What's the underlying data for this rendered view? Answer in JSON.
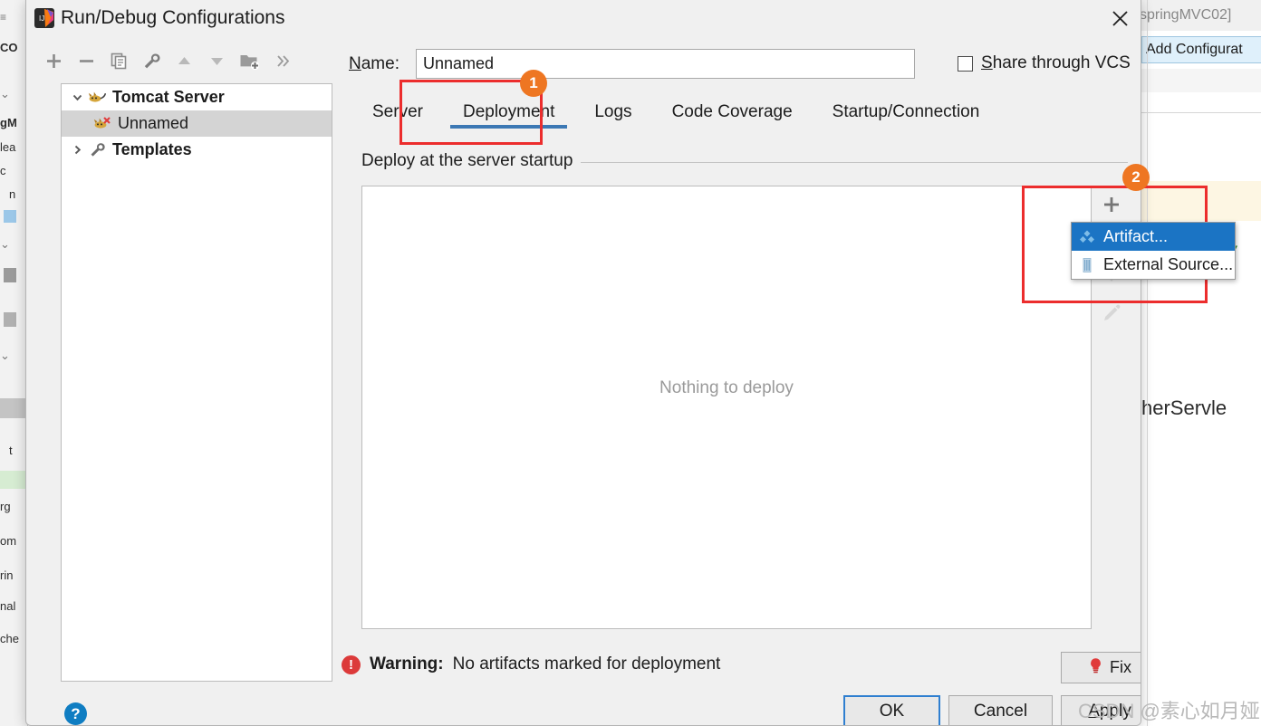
{
  "background": {
    "window_title": "springMVC02]",
    "add_config_button": "Add Configurat",
    "code_comment": "//",
    "code_word": "herServle",
    "left_lines": [
      "CO",
      "gM",
      "lea",
      "c",
      "n",
      "t",
      "rg",
      "om",
      "rin",
      "nal",
      "che"
    ]
  },
  "dialog": {
    "title": "Run/Debug Configurations",
    "title_icon": "intellij-idea-icon",
    "close_icon": "close-icon",
    "toolbar": [
      {
        "name": "add-configuration-button",
        "icon": "plus-icon"
      },
      {
        "name": "remove-configuration-button",
        "icon": "minus-icon"
      },
      {
        "name": "copy-configuration-button",
        "icon": "copy-icon"
      },
      {
        "name": "edit-templates-button",
        "icon": "wrench-icon"
      },
      {
        "name": "move-up-button",
        "icon": "arrow-up-icon"
      },
      {
        "name": "move-down-button",
        "icon": "arrow-down-icon"
      },
      {
        "name": "create-folder-button",
        "icon": "folder-plus-icon"
      },
      {
        "name": "more-options-button",
        "icon": "chevron-double-right-icon"
      }
    ],
    "tree": [
      {
        "label": "Tomcat Server",
        "icon": "tomcat-cat-icon",
        "twisty": "chevron-down-icon",
        "bold": true,
        "selected": false,
        "indent": false
      },
      {
        "label": "Unnamed",
        "icon": "tomcat-cat-red-icon",
        "twisty": "",
        "bold": false,
        "selected": true,
        "indent": true
      },
      {
        "label": "Templates",
        "icon": "wrench-icon",
        "twisty": "chevron-right-icon",
        "bold": true,
        "selected": false,
        "indent": false
      }
    ],
    "name_label": "Name:",
    "name_label_mnemonic": "N",
    "name_label_rest": "ame:",
    "name_value": "Unnamed",
    "share_checkbox": {
      "label_mnemonic": "S",
      "label_rest": "hare through VCS",
      "checked": false,
      "help_icon": "question-mark-icon"
    },
    "tabs": [
      {
        "label": "Server",
        "active": false
      },
      {
        "label": "Deployment",
        "active": true
      },
      {
        "label": "Logs",
        "active": false
      },
      {
        "label": "Code Coverage",
        "active": false
      },
      {
        "label": "Startup/Connection",
        "active": false
      }
    ],
    "group_title": "Deploy at the server startup",
    "empty_text": "Nothing to deploy",
    "side_toolbar": [
      {
        "name": "add-artifact-button",
        "icon": "plus-icon",
        "enabled": true
      },
      {
        "name": "remove-artifact-button",
        "icon": "minus-icon",
        "enabled": false
      },
      {
        "name": "move-down-artifact-button",
        "icon": "arrow-down-icon",
        "enabled": false
      },
      {
        "name": "edit-artifact-button",
        "icon": "pencil-icon",
        "enabled": false
      }
    ],
    "popup_menu": [
      {
        "label": "Artifact...",
        "icon": "artifact-diamond-icon",
        "highlighted": true
      },
      {
        "label": "External Source...",
        "icon": "external-source-icon",
        "highlighted": false
      }
    ],
    "warning": {
      "icon": "error-circle-icon",
      "prefix": "Warning:",
      "message": "No artifacts marked for deployment"
    },
    "fix_button": {
      "label": "Fix",
      "icon": "lightbulb-icon"
    },
    "help_button": {
      "icon": "question-mark-icon",
      "label": "?"
    },
    "buttons": {
      "ok": "OK",
      "cancel": "Cancel",
      "apply_mnemonic": "A",
      "apply_rest": "pply"
    }
  },
  "annotations": [
    {
      "badge": "1",
      "target": "deployment-tab"
    },
    {
      "badge": "2",
      "target": "add-artifact-popup"
    }
  ],
  "watermark": "CSDN @素心如月娅",
  "colors": {
    "accent_blue": "#3c78b4",
    "highlight_blue": "#1b74c4",
    "annotation_red": "#ec2d2d",
    "badge_orange": "#ee7622",
    "warning_red": "#dc3a3a",
    "dialog_bg": "#f0f0f0"
  }
}
